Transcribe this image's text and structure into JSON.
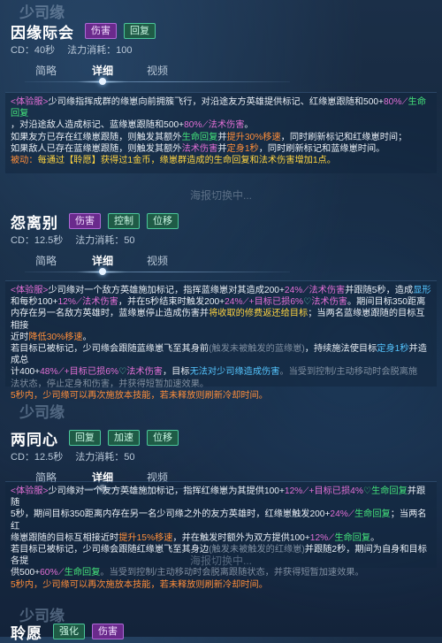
{
  "header_ghost": "少司缘",
  "sections": [
    {
      "name": "因缘际会",
      "tags": [
        {
          "label": "伤害",
          "color": "purple"
        },
        {
          "label": "回复",
          "color": "green"
        }
      ],
      "cd": "CD：40秒",
      "cost": "法力消耗：100",
      "tabs": [
        "简略",
        "详细",
        "视频"
      ],
      "active_tab": "详细",
      "lines": {
        "l1a": "<体验服>",
        "l1b": "少司缘指挥成群的缘崽向前拥簇飞行，对沿途友方英雄提供标记、红缘崽跟随和500+",
        "l1c": "80%",
        "l1d": "生命回复",
        "l2a": "，对沿途敌人造成标记、蓝缘崽跟随和500+",
        "l2b": "80%",
        "l2c": "法术伤害",
        "l2d": "。",
        "l3a": "如果友方已存在红缘崽跟随，则触发其额外",
        "l3b": "生命回复",
        "l3c": "并",
        "l3d": "提升30%移速",
        "l3e": "，同时刷新标记和红缘崽时间；",
        "l4a": "如果敌人已存在蓝缘崽跟随，则触发其额外",
        "l4b": "法术伤害",
        "l4c": "并",
        "l4d": "定身1秒",
        "l4e": "，同时刷新标记和蓝缘崽时间。",
        "l5a": "被动：",
        "l5b": "每通过【聆愿】获得过1金币，缘崽群造成的生命回复和法术伤害增加1点。"
      },
      "footer": "海报切换中..."
    },
    {
      "name": "怨离别",
      "tags": [
        {
          "label": "伤害",
          "color": "purple"
        },
        {
          "label": "控制",
          "color": "green"
        },
        {
          "label": "位移",
          "color": "green"
        }
      ],
      "cd": "CD：12.5秒",
      "cost": "法力消耗：50",
      "tabs": [
        "简略",
        "详细",
        "视频"
      ],
      "active_tab": "详细",
      "lines": {
        "l1a": "<体验服>",
        "l1b": "少司缘对一个敌方英雄施加标记，指挥蓝缘崽对其造成200+",
        "l1c": "24%",
        "l1d": "法术伤害",
        "l1e": "并跟随5秒，造成",
        "l1f": "显形",
        "l2a": "和每秒100+",
        "l2b": "12%",
        "l2c": "法术伤害",
        "l2d": "，并在5秒结束时触发200+",
        "l2e": "24%",
        "l2f": "+目标已损6%",
        "l2g": "法术伤害",
        "l2h": "。期间目标350距离",
        "l3a": "内存在另一名敌方英雄时，蓝缘崽停止造成伤害并",
        "l3b": "将收取的修费返还给目标",
        "l3c": "；当两名蓝缘崽跟随的目标互相接",
        "l4a": "近时",
        "l4b": "降低30%移速",
        "l4c": "。",
        "l5a": "若目标已被标记，少司缘会跟随蓝缘崽飞至其身前",
        "l5b": "(触发未被触发的蓝缘崽)",
        "l5c": "，持续施法使目标",
        "l5d": "定身1秒",
        "l5e": "并造成总",
        "l6a": "计400+",
        "l6b": "48%",
        "l6c": "+目标已损6%",
        "l6d": "法术伤害",
        "l6e": "，目标",
        "l6f": "无法对少司缘造成伤害",
        "l6g": "。当受到控制/主动移动时会脱离施",
        "l7a": "法状态，停止定身和伤害，并获得短暂加速效果。",
        "l8a": "5秒内，少司缘可以再次施放本技能，若未释放则刷新冷却时间。"
      },
      "footer": ""
    },
    {
      "name": "两同心",
      "tags": [
        {
          "label": "回复",
          "color": "green"
        },
        {
          "label": "加速",
          "color": "green"
        },
        {
          "label": "位移",
          "color": "green"
        }
      ],
      "cd": "CD：12.5秒",
      "cost": "法力消耗：50",
      "tabs": [
        "简略",
        "详细",
        "视频"
      ],
      "active_tab": "详细",
      "lines": {
        "l1a": "<体验服>",
        "l1b": "少司缘对一个友方英雄施加标记，指挥红缘崽为其提供100+",
        "l1c": "12%",
        "l1d": "+目标已损4%",
        "l1e": "生命回复",
        "l1f": "并跟随",
        "l2a": "5秒，期间目标350距离内存在另一名少司缘之外的友方英雄时，红缘崽触发200+",
        "l2b": "24%",
        "l2c": "生命回复",
        "l2d": "；当两名红",
        "l3a": "缘崽跟随的目标互相接近时",
        "l3b": "提升15%移速",
        "l3c": "，并在触发时额外为双方提供100+",
        "l3d": "12%",
        "l3e": "生命回复",
        "l3f": "。",
        "l4a": "若目标已被标记，少司缘会跟随红缘崽飞至其身边",
        "l4b": "(触发未被触发的红缘崽)",
        "l4c": "并跟随2秒，期间为自身和目标各提",
        "l5a": "供500+",
        "l5b": "60%",
        "l5c": "生命回复",
        "l5d": "。当受到控制/主动移动时会脱离跟随状态，并获得短暂加速效果。",
        "l6a": "5秒内，少司缘可以再次施放本技能，若未释放则刷新冷却时间。"
      },
      "footer": "海报切换中..."
    }
  ],
  "bottom_ghost": "少司缘",
  "bottom_section": {
    "name": "聆愿",
    "tags": [
      {
        "label": "强化",
        "color": "green"
      },
      {
        "label": "伤害",
        "color": "purple"
      }
    ]
  },
  "mid_ghost": "少司缘"
}
